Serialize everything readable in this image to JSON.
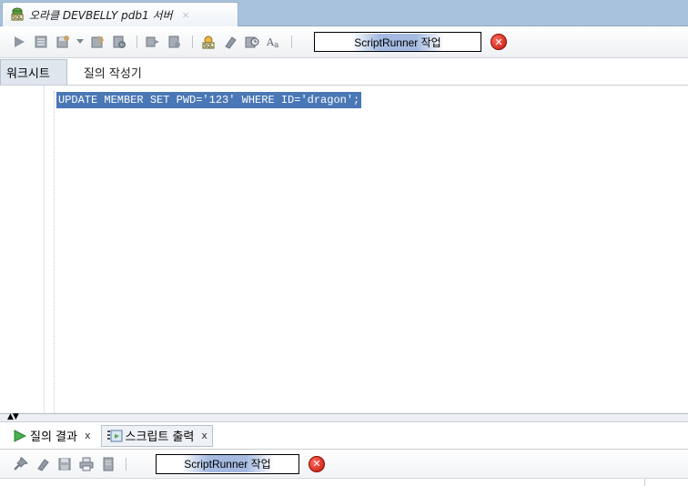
{
  "document_tab": {
    "title": "오라클 DEVBELLY pdb1 서버",
    "close": "×",
    "icon": "sql-connection-icon"
  },
  "toolbar": {
    "icons": [
      "run-statement-icon",
      "run-script-icon",
      "commit-icon",
      "dropdown-arrow-icon",
      "rollback-icon",
      "explain-plan-icon",
      "autotrace-icon",
      "unshared-sql-icon",
      "sql-tuning-icon",
      "clear-icon",
      "history-icon",
      "format-icon"
    ],
    "task_label": "ScriptRunner 작업",
    "cancel_icon": "cancel-task-icon"
  },
  "editor_tabs": {
    "worksheet": "워크시트",
    "query_builder": "질의 작성기"
  },
  "editor": {
    "code": "UPDATE MEMBER SET PWD='123' WHERE ID='dragon';",
    "selection_color": "#4a77b5"
  },
  "splitter": {
    "arrows": "▲▼"
  },
  "panel_tabs": {
    "query_result": "질의 결과",
    "query_result_close": "x",
    "script_output": "스크립트 출력",
    "script_output_close": "x"
  },
  "bottom_toolbar": {
    "icons": [
      "pin-icon",
      "eraser-icon",
      "save-icon",
      "print-icon",
      "file-icon"
    ],
    "task_label": "ScriptRunner 작업",
    "cancel_icon": "cancel-task-icon"
  },
  "colors": {
    "tabbar": "#a9c2dc",
    "selection": "#4a77b5",
    "cancel": "#d42215"
  }
}
